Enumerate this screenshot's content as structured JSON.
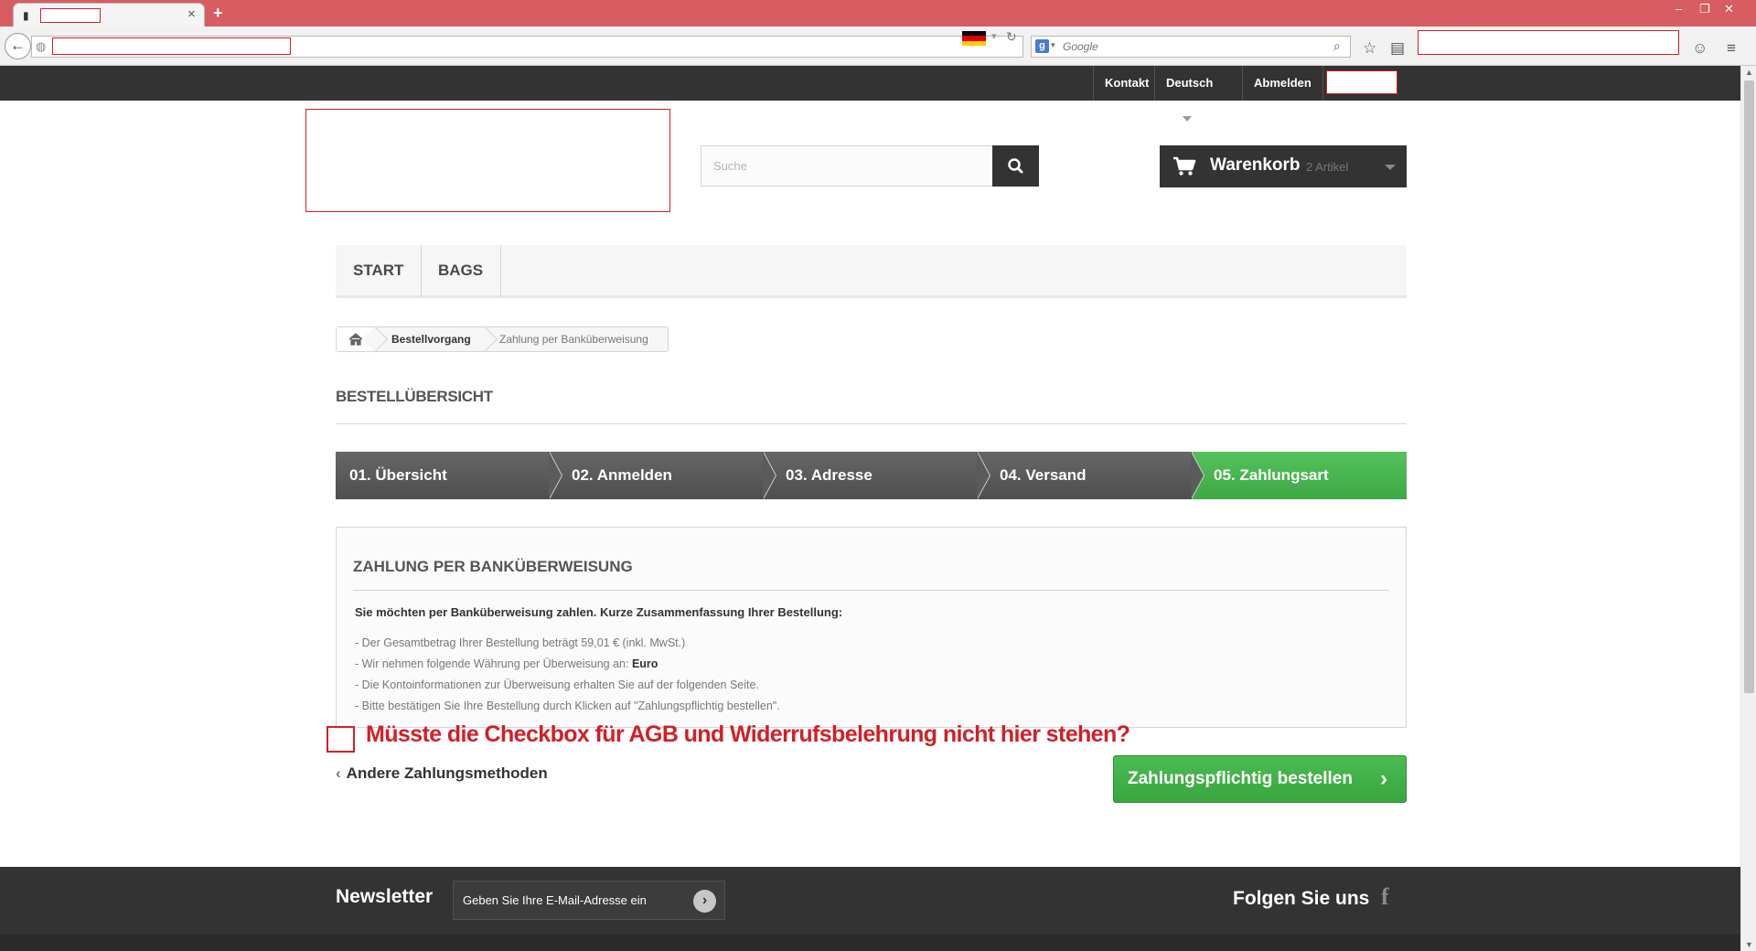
{
  "browser": {
    "tab_close": "×",
    "new_tab": "+",
    "search_placeholder": "Google",
    "window_controls": [
      "–",
      "❐",
      "✕"
    ]
  },
  "topbar": {
    "links": [
      "Kontakt",
      "Deutsch",
      "Abmelden"
    ]
  },
  "header": {
    "search_placeholder": "Suche",
    "cart_title": "Warenkorb",
    "cart_count": "2 Artikel"
  },
  "menu": [
    "START",
    "BAGS"
  ],
  "breadcrumb": {
    "step1": "Bestellvorgang",
    "step2": "Zahlung per Banküberweisung"
  },
  "page_heading": "BESTELLÜBERSICHT",
  "steps": [
    "01. Übersicht",
    "02. Anmelden",
    "03. Adresse",
    "04. Versand",
    "05. Zahlungsart"
  ],
  "active_step": 5,
  "payment": {
    "title": "ZAHLUNG PER BANKÜBERWEISUNG",
    "lead": "Sie möchten per Banküberweisung zahlen. Kurze Zusammenfassung Ihrer Bestellung:",
    "line1": "- Der Gesamtbetrag Ihrer Bestellung beträgt 59,01 € (inkl. MwSt.)",
    "line2_prefix": "- Wir nehmen folgende Währung per Überweisung an: ",
    "line2_currency": "Euro",
    "line3": "- Die Kontoinformationen zur Überweisung erhalten Sie auf der folgenden Seite.",
    "line4": "- Bitte bestätigen Sie Ihre Bestellung durch Klicken auf \"Zahlungspflichtig bestellen\"."
  },
  "annotation": "Müsste die Checkbox für AGB und Widerrufsbelehrung nicht hier stehen?",
  "actions": {
    "back": "Andere Zahlungsmethoden",
    "order": "Zahlungspflichtig bestellen"
  },
  "footer": {
    "newsletter_title": "Newsletter",
    "newsletter_placeholder": "Geben Sie Ihre E-Mail-Adresse ein",
    "follow_title": "Folgen Sie uns",
    "facebook_icon": "f"
  },
  "colors": {
    "annotation_red": "#d21f27",
    "step_active": "#4bb553",
    "dark": "#333333",
    "browser_chrome": "#d75d62"
  }
}
